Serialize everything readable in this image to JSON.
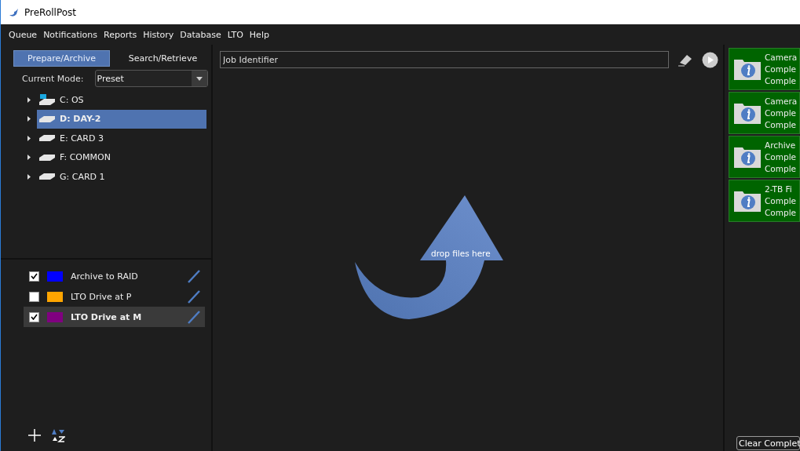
{
  "window": {
    "title": "PreRollPost"
  },
  "menu": [
    "Queue",
    "Notifications",
    "Reports",
    "History",
    "Database",
    "LTO",
    "Help"
  ],
  "tabs": [
    {
      "label": "Prepare/Archive",
      "selected": true
    },
    {
      "label": "Search/Retrieve",
      "selected": false
    }
  ],
  "mode": {
    "label": "Current Mode:",
    "value": "Preset"
  },
  "job": {
    "placeholder": "Job Identifier"
  },
  "drives": [
    {
      "label": "C: OS",
      "kind": "system",
      "selected": false
    },
    {
      "label": "D: DAY-2",
      "kind": "disk",
      "selected": true
    },
    {
      "label": "E: CARD 3",
      "kind": "disk",
      "selected": false
    },
    {
      "label": "F: COMMON",
      "kind": "disk",
      "selected": false
    },
    {
      "label": "G: CARD 1",
      "kind": "disk",
      "selected": false
    }
  ],
  "presets": [
    {
      "name": "Archive to RAID",
      "checked": true,
      "color": "#0000ff",
      "selected": false
    },
    {
      "name": "LTO Drive at P",
      "checked": false,
      "color": "#ffa500",
      "selected": false
    },
    {
      "name": "LTO Drive at M",
      "checked": true,
      "color": "#800080",
      "selected": true
    }
  ],
  "drop_hint": "drop files here",
  "notifications": [
    {
      "lines": [
        "Camera",
        "Comple",
        "Comple"
      ]
    },
    {
      "lines": [
        "Camera",
        "Comple",
        "Comple"
      ]
    },
    {
      "lines": [
        "Archive",
        "Comple",
        "Comple"
      ]
    },
    {
      "lines": [
        "2-TB Fi",
        "Comple",
        "Comple"
      ]
    }
  ],
  "clear_button": "Clear Complet"
}
